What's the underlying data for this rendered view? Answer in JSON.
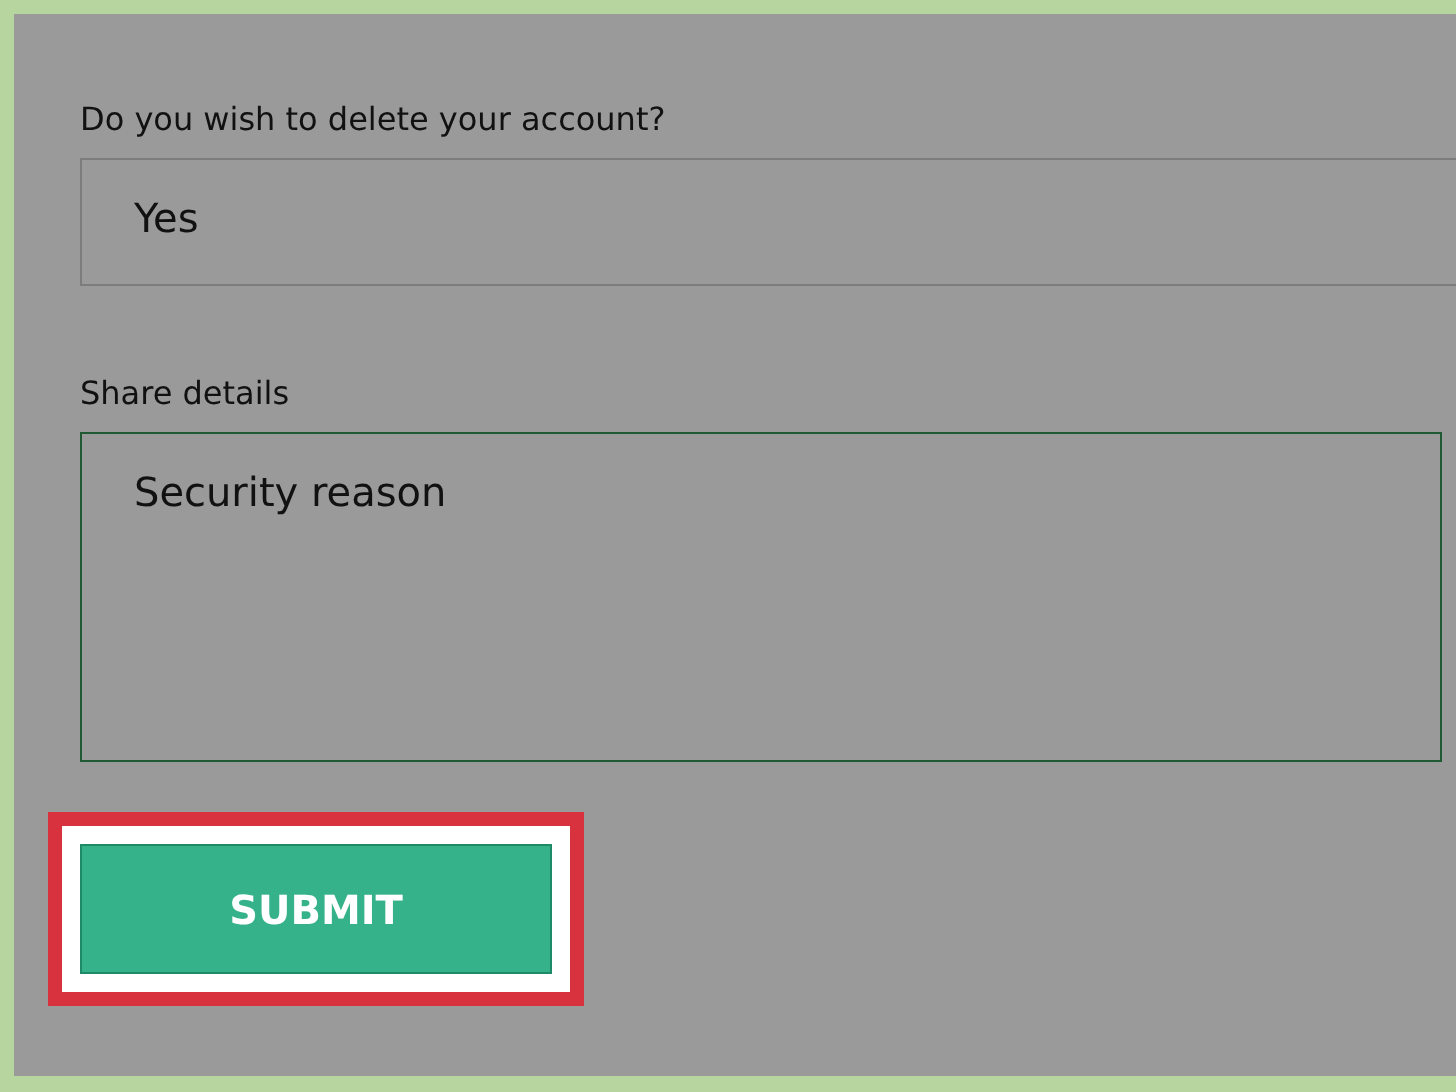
{
  "delete_question": {
    "label": "Do you wish to delete your account?",
    "value": "Yes"
  },
  "details": {
    "label": "Share details",
    "value": "Security reason",
    "focused": true
  },
  "submit_button": {
    "label": "SUBMIT",
    "highlighted": true
  }
}
